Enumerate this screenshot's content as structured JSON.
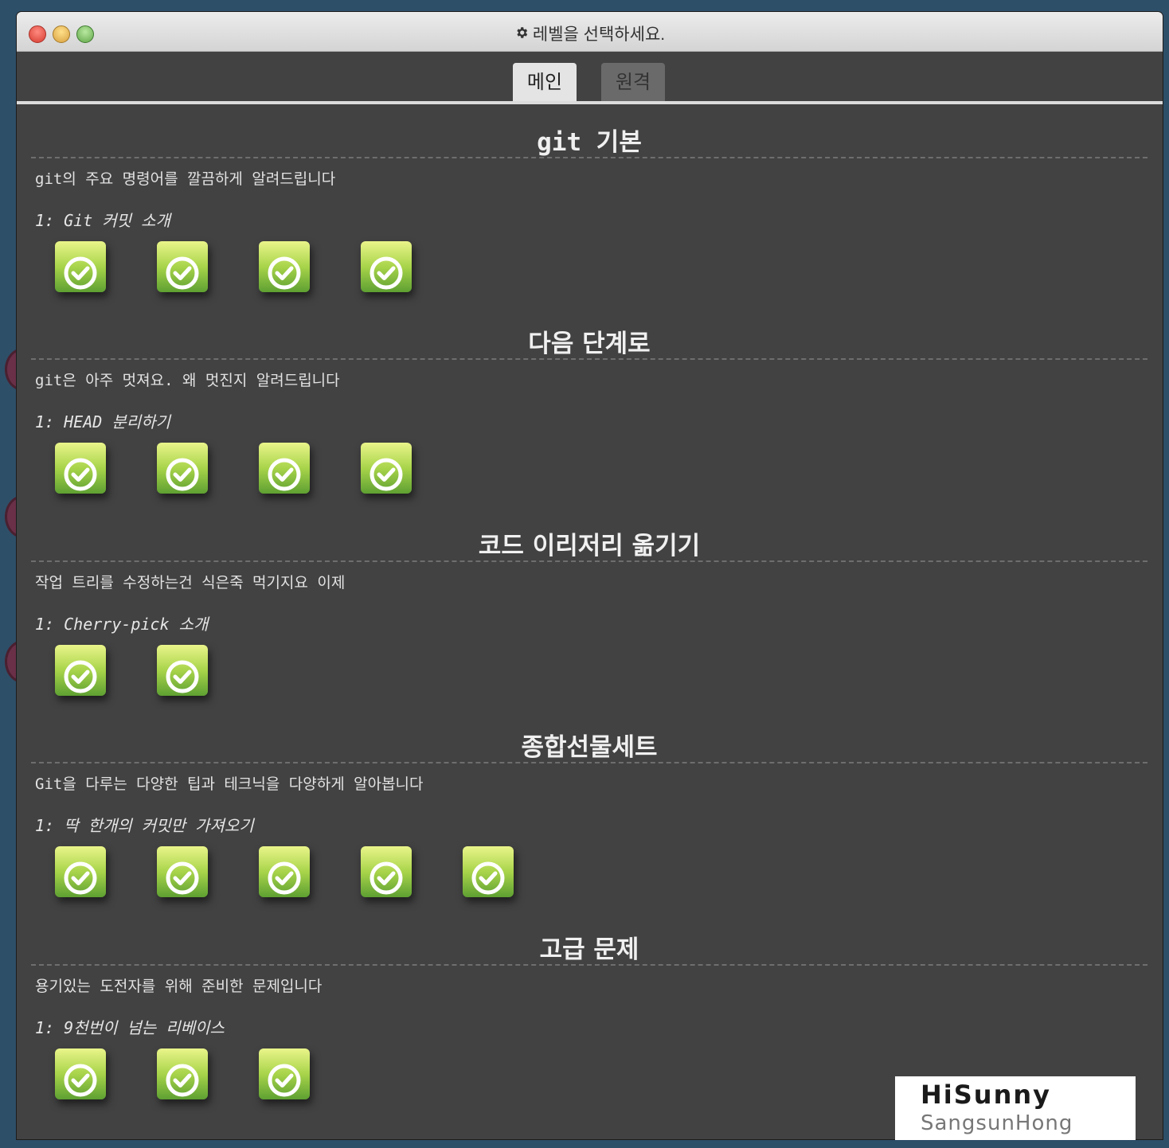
{
  "window": {
    "title": "레벨을 선택하세요.",
    "title_icon": "gear-icon"
  },
  "tabs": [
    {
      "label": "메인",
      "active": true
    },
    {
      "label": "원격",
      "active": false
    }
  ],
  "sections": [
    {
      "title": "git 기본",
      "description": "git의 주요 명령어를 깔끔하게 알려드립니다",
      "first_level": "1: Git 커밋 소개",
      "level_count": 4,
      "levels_completed": [
        true,
        true,
        true,
        true
      ]
    },
    {
      "title": "다음 단계로",
      "description": "git은 아주 멋져요. 왜 멋진지 알려드립니다",
      "first_level": "1: HEAD 분리하기",
      "level_count": 4,
      "levels_completed": [
        true,
        true,
        true,
        true
      ]
    },
    {
      "title": "코드 이리저리 옮기기",
      "description": "작업 트리를 수정하는건 식은죽 먹기지요 이제",
      "first_level": "1: Cherry-pick 소개",
      "level_count": 2,
      "levels_completed": [
        true,
        true
      ]
    },
    {
      "title": "종합선물세트",
      "description": "Git을 다루는 다양한 팁과 테크닉을 다양하게 알아봅니다",
      "first_level": "1: 딱 한개의 커밋만 가져오기",
      "level_count": 5,
      "levels_completed": [
        true,
        true,
        true,
        true,
        true
      ]
    },
    {
      "title": "고급 문제",
      "description": "용기있는 도전자를 위해 준비한 문제입니다",
      "first_level": "1: 9천번이 넘는 리베이스",
      "level_count": 3,
      "levels_completed": [
        true,
        true,
        true
      ]
    }
  ],
  "watermark": {
    "line1": "HiSunny",
    "line2": "SangsunHong"
  },
  "colors": {
    "window_bg": "#424242",
    "level_green_top": "#eaf58a",
    "level_green_bottom": "#5ea032"
  }
}
